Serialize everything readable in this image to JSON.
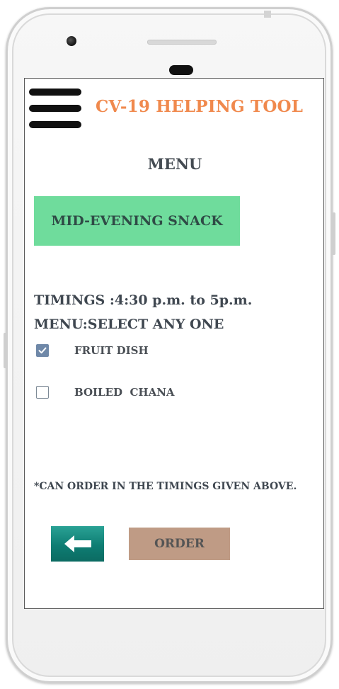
{
  "app": {
    "title": "CV-19 HELPING TOOL"
  },
  "page": {
    "heading": "MENU",
    "meal_name": "MID-EVENING SNACK",
    "timings": "TIMINGS :4:30 p.m. to 5p.m.",
    "instruction": "MENU:SELECT ANY ONE",
    "footnote": "*CAN ORDER IN THE TIMINGS GIVEN ABOVE."
  },
  "options": [
    {
      "label": "FRUIT DISH",
      "checked": true
    },
    {
      "label": "BOILED  CHANA",
      "checked": false
    }
  ],
  "buttons": {
    "back_icon": "left-arrow-icon",
    "order_label": "ORDER"
  },
  "colors": {
    "title": "#f0894d",
    "meal_badge": "#6fdc9c",
    "back_button": "#0e7d73",
    "order_button": "#bf9b85",
    "checkbox_checked": "#6f88a8"
  }
}
